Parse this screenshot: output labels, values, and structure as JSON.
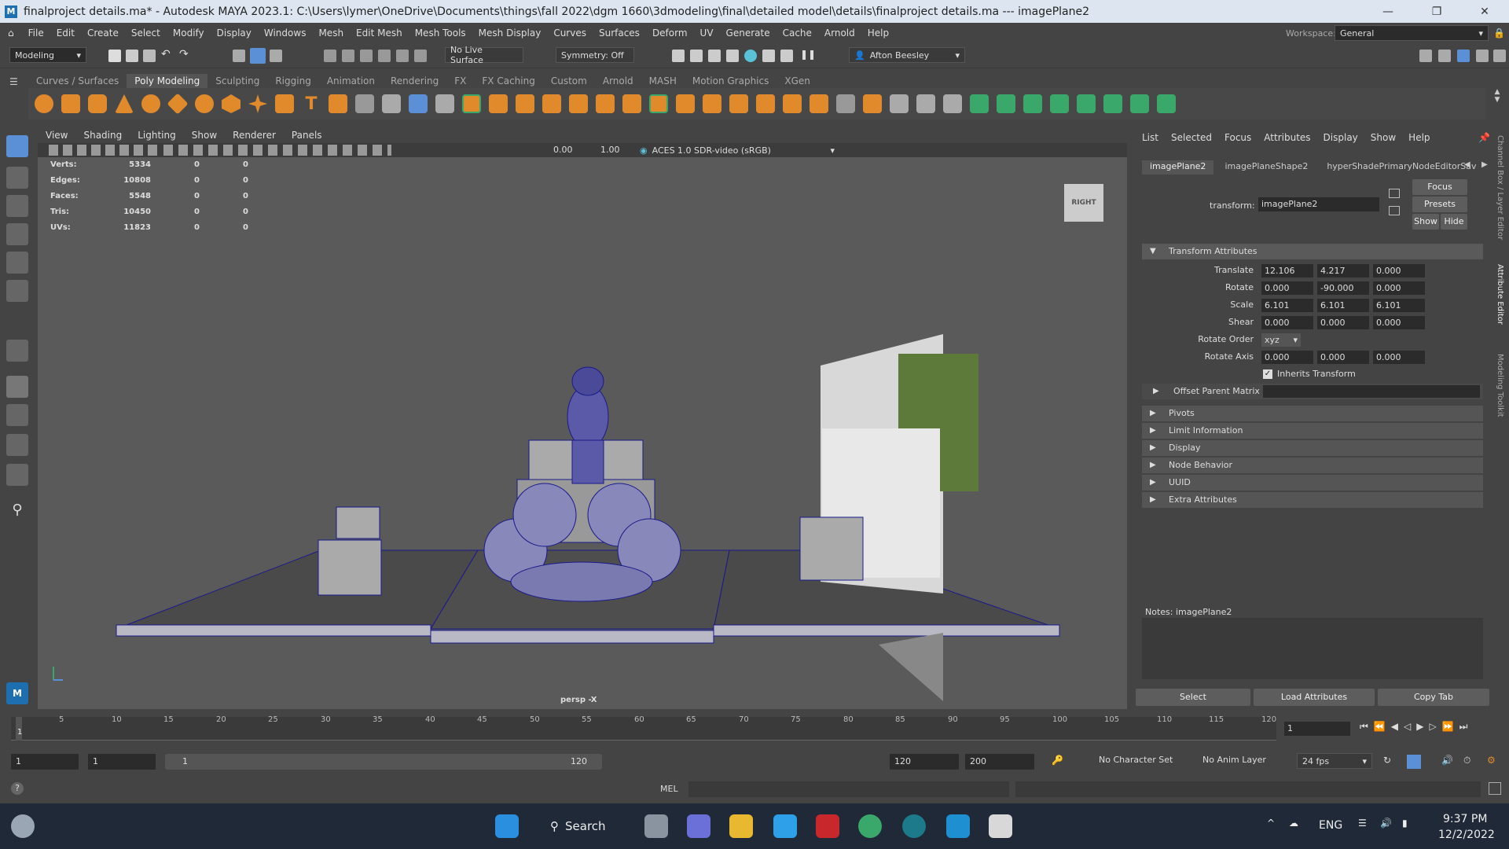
{
  "window": {
    "title": "finalproject details.ma* - Autodesk MAYA 2023.1: C:\\Users\\lymer\\OneDrive\\Documents\\things\\fall 2022\\dgm 1660\\3dmodeling\\final\\detailed model\\details\\finalproject details.ma  ---  imagePlane2",
    "logo": "M"
  },
  "menubar": {
    "items": [
      "File",
      "Edit",
      "Create",
      "Select",
      "Modify",
      "Display",
      "Windows",
      "Mesh",
      "Edit Mesh",
      "Mesh Tools",
      "Mesh Display",
      "Curves",
      "Surfaces",
      "Deform",
      "UV",
      "Generate",
      "Cache",
      "Arnold",
      "Help"
    ],
    "workspace_label": "Workspace:",
    "workspace_value": "General"
  },
  "toolbar": {
    "mode": "Modeling",
    "live_surface": "No Live Surface",
    "symmetry": "Symmetry: Off",
    "user": "Afton Beesley"
  },
  "shelf": {
    "tabs": [
      "Curves / Surfaces",
      "Poly Modeling",
      "Sculpting",
      "Rigging",
      "Animation",
      "Rendering",
      "FX",
      "FX Caching",
      "Custom",
      "Arnold",
      "MASH",
      "Motion Graphics",
      "XGen"
    ],
    "active": "Poly Modeling"
  },
  "viewport": {
    "menus": [
      "View",
      "Shading",
      "Lighting",
      "Show",
      "Renderer",
      "Panels"
    ],
    "exposure": "0.00",
    "gamma": "1.00",
    "colorspace": "ACES 1.0 SDR-video (sRGB)",
    "stats": [
      {
        "label": "Verts:",
        "a": "5334",
        "b": "0",
        "c": "0"
      },
      {
        "label": "Edges:",
        "a": "10808",
        "b": "0",
        "c": "0"
      },
      {
        "label": "Faces:",
        "a": "5548",
        "b": "0",
        "c": "0"
      },
      {
        "label": "Tris:",
        "a": "10450",
        "b": "0",
        "c": "0"
      },
      {
        "label": "UVs:",
        "a": "11823",
        "b": "0",
        "c": "0"
      }
    ],
    "viewcube": "RIGHT",
    "camera": "persp -X"
  },
  "attr_editor": {
    "menus": [
      "List",
      "Selected",
      "Focus",
      "Attributes",
      "Display",
      "Show",
      "Help"
    ],
    "tabs": [
      "imagePlane2",
      "imagePlaneShape2",
      "hyperShadePrimaryNodeEditorSav"
    ],
    "transform_label": "transform:",
    "transform_value": "imagePlane2",
    "focus": "Focus",
    "presets": "Presets",
    "show": "Show",
    "hide": "Hide",
    "section": "Transform Attributes",
    "translate": {
      "label": "Translate",
      "x": "12.106",
      "y": "4.217",
      "z": "0.000"
    },
    "rotate": {
      "label": "Rotate",
      "x": "0.000",
      "y": "-90.000",
      "z": "0.000"
    },
    "scale": {
      "label": "Scale",
      "x": "6.101",
      "y": "6.101",
      "z": "6.101"
    },
    "shear": {
      "label": "Shear",
      "x": "0.000",
      "y": "0.000",
      "z": "0.000"
    },
    "rotate_order": {
      "label": "Rotate Order",
      "value": "xyz"
    },
    "rotate_axis": {
      "label": "Rotate Axis",
      "x": "0.000",
      "y": "0.000",
      "z": "0.000"
    },
    "inherits": "Inherits Transform",
    "offset": "Offset Parent Matrix",
    "sections": [
      "Pivots",
      "Limit Information",
      "Display",
      "Node Behavior",
      "UUID",
      "Extra Attributes"
    ],
    "notes": "Notes: imagePlane2",
    "buttons": [
      "Select",
      "Load Attributes",
      "Copy Tab"
    ]
  },
  "side_tabs": [
    "Channel Box / Layer Editor",
    "Attribute Editor",
    "Modeling Toolkit"
  ],
  "timeline": {
    "ticks": [
      "5",
      "10",
      "15",
      "20",
      "25",
      "30",
      "35",
      "40",
      "45",
      "50",
      "55",
      "60",
      "65",
      "70",
      "75",
      "80",
      "85",
      "90",
      "95",
      "100",
      "105",
      "110",
      "115",
      "120"
    ],
    "current": "1",
    "frame_field": "1"
  },
  "range": {
    "start": "1",
    "anim_start": "1",
    "slider_start": "1",
    "slider_end": "120",
    "end": "120",
    "anim_end": "200",
    "char_set": "No Character Set",
    "anim_layer": "No Anim Layer",
    "fps": "24 fps"
  },
  "cmd": {
    "lang": "MEL"
  },
  "taskbar": {
    "search": "Search",
    "lang": "ENG",
    "time": "9:37 PM",
    "date": "12/2/2022"
  },
  "colors": {
    "accent": "#1e6fb0",
    "shelf_orange": "#e08a2c",
    "shelf_green": "#3aa86b",
    "wire": "#1a1a8a"
  }
}
